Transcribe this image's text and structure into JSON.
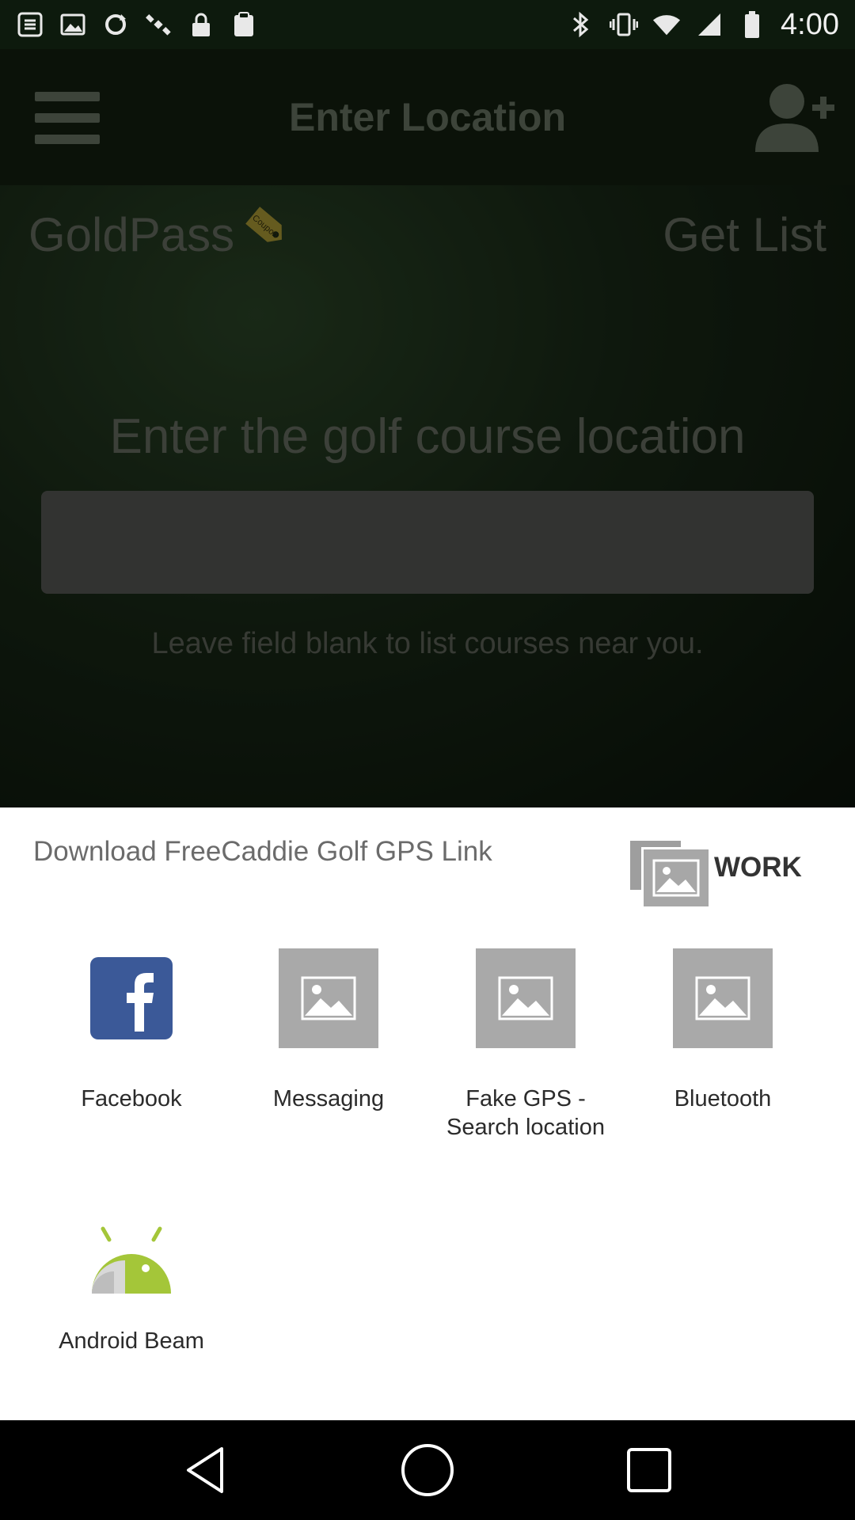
{
  "status_bar": {
    "time": "4:00",
    "left_icons": [
      "app-notification-icon",
      "image-notification-icon",
      "refresh-icon",
      "satellite-icon",
      "lock-icon",
      "clipboard-icon"
    ],
    "right_icons": [
      "bluetooth-icon",
      "vibrate-icon",
      "wifi-icon",
      "signal-icon",
      "battery-icon"
    ]
  },
  "app": {
    "toolbar": {
      "title": "Enter Location"
    },
    "goldpass_label": "GoldPass",
    "coupon_tag": "Coupon",
    "get_list_label": "Get List",
    "course_heading": "Enter the golf course location",
    "location_input": {
      "value": "",
      "placeholder": ""
    },
    "hint": "Leave field blank to list courses near you."
  },
  "share_sheet": {
    "title": "Download FreeCaddie Golf GPS Link",
    "work_badge": "WORK",
    "apps": [
      {
        "label": "Facebook",
        "icon": "facebook-icon"
      },
      {
        "label": "Messaging",
        "icon": "image-placeholder-icon"
      },
      {
        "label": "Fake GPS - Search location",
        "icon": "image-placeholder-icon"
      },
      {
        "label": "Bluetooth",
        "icon": "image-placeholder-icon"
      },
      {
        "label": "Android Beam",
        "icon": "android-beam-icon"
      }
    ]
  },
  "nav_bar": {
    "buttons": [
      "back-icon",
      "home-icon",
      "recents-icon"
    ]
  },
  "colors": {
    "facebook_blue": "#3b5998",
    "android_green": "#a4c639",
    "placeholder_gray": "#a9a9a9"
  }
}
